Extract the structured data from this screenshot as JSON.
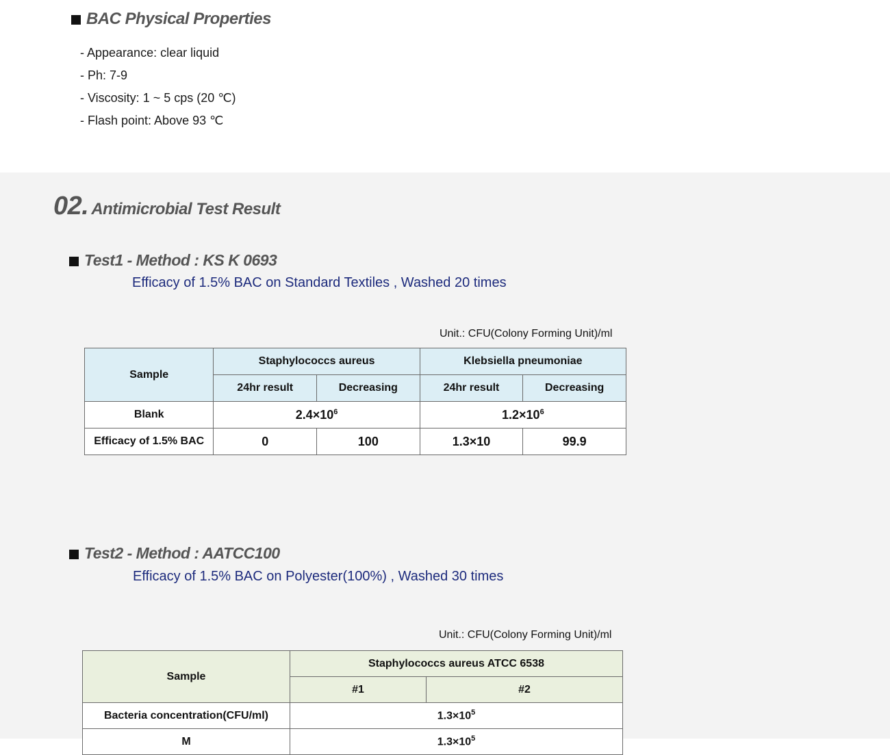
{
  "props": {
    "title": "BAC Physical Properties",
    "items": [
      "- Appearance: clear liquid",
      "- Ph: 7-9",
      "- Viscosity: 1 ~ 5 cps (20 ℃)",
      "- Flash point: Above 93 ℃"
    ]
  },
  "section": {
    "number": "02",
    "dot": ".",
    "title": "Antimicrobial Test Result"
  },
  "test1": {
    "title": "Test1  -  Method : KS K 0693",
    "subtitle": "Efficacy of 1.5% BAC on Standard Textiles , Washed 20 times",
    "unit": "Unit.: CFU(Colony Forming Unit)/ml",
    "table": {
      "sample_header": "Sample",
      "organism1": "Staphylococcs aureus",
      "organism2": "Klebsiella  pneumoniae",
      "col_24hr": "24hr result",
      "col_decreasing": "Decreasing",
      "row_blank": "Blank",
      "blank_val1_base": "2.4×10",
      "blank_val1_exp": "6",
      "blank_val2_base": "1.2×10",
      "blank_val2_exp": "6",
      "row_efficacy": "Efficacy of 1.5% BAC",
      "eff_sa_24hr": "0",
      "eff_sa_dec": "100",
      "eff_kp_24hr": "1.3×10",
      "eff_kp_dec": "99.9"
    }
  },
  "test2": {
    "title": "Test2  -  Method : AATCC100",
    "subtitle": "Efficacy of 1.5% BAC on Polyester(100%) , Washed 30 times",
    "unit": "Unit.: CFU(Colony Forming Unit)/ml",
    "table": {
      "sample_header": "Sample",
      "organism": "Staphylococcs aureus ATCC 6538",
      "col1": "#1",
      "col2": "#2",
      "row_bacteria": "Bacteria concentration(CFU/ml)",
      "bacteria_base": "1.3×10",
      "bacteria_exp": "5",
      "row_partial": "M",
      "partial_base": "1.3×10",
      "partial_exp": "5"
    }
  }
}
